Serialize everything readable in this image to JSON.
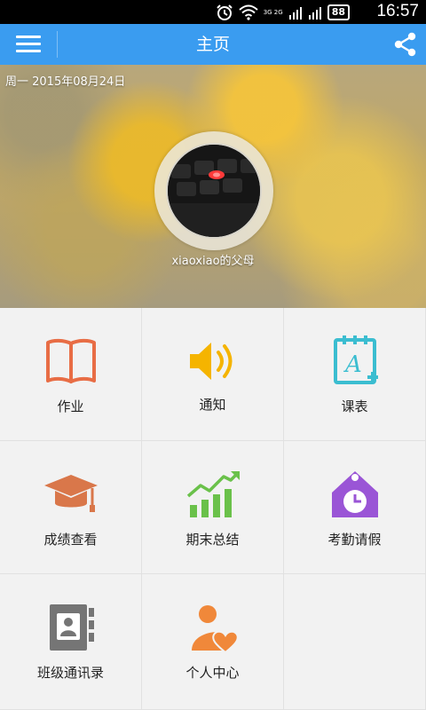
{
  "status_bar": {
    "time": "16:57",
    "battery": "88",
    "network": "3G 2G"
  },
  "header": {
    "title": "主页"
  },
  "profile": {
    "date": "周一 2015年08月24日",
    "name": "xiaoxiao的父母"
  },
  "menu": [
    {
      "label": "作业",
      "icon": "book-icon",
      "color": "#e86d45"
    },
    {
      "label": "通知",
      "icon": "speaker-icon",
      "color": "#f5b400"
    },
    {
      "label": "课表",
      "icon": "schedule-icon",
      "color": "#3bbdd0"
    },
    {
      "label": "成绩查看",
      "icon": "graduation-cap-icon",
      "color": "#d9774a"
    },
    {
      "label": "期末总结",
      "icon": "growth-chart-icon",
      "color": "#6ac14a"
    },
    {
      "label": "考勤请假",
      "icon": "attendance-clock-icon",
      "color": "#9a55d6"
    },
    {
      "label": "班级通讯录",
      "icon": "contacts-book-icon",
      "color": "#757575"
    },
    {
      "label": "个人中心",
      "icon": "user-heart-icon",
      "color": "#f0883a"
    }
  ]
}
